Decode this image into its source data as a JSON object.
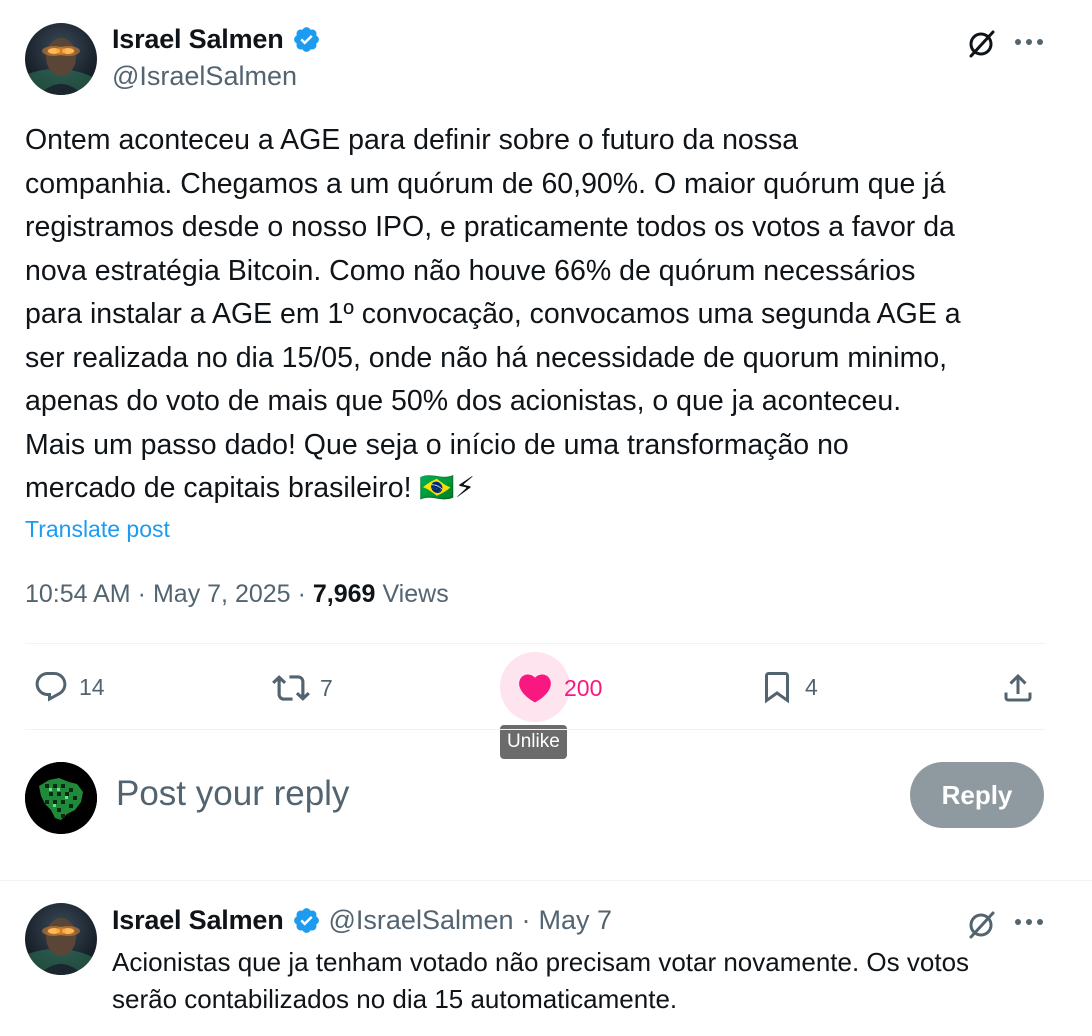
{
  "post": {
    "author_name": "Israel Salmen",
    "author_handle": "@IsraelSalmen",
    "text_lines": [
      "Ontem aconteceu a AGE para definir sobre o futuro da nossa",
      "companhia. Chegamos a um quórum de 60,90%. O maior quórum que já",
      "registramos desde o nosso IPO, e praticamente todos os votos a favor da",
      "nova estratégia Bitcoin. Como não houve 66% de quórum necessários",
      "para instalar a AGE em 1º convocação, convocamos uma segunda AGE a",
      "ser realizada no dia 15/05, onde não há necessidade de quorum minimo,",
      "apenas do voto de mais que 50% dos acionistas, o que ja aconteceu.",
      "Mais um passo dado! Que seja o início de uma transformação no",
      "mercado de capitais brasileiro! 🇧🇷⚡"
    ],
    "translate_label": "Translate post",
    "time": "10:54 AM",
    "date": "May 7, 2025",
    "views_count": "7,969",
    "views_label": "Views",
    "separator": "·"
  },
  "actions": {
    "replies": "14",
    "reposts": "7",
    "likes": "200",
    "bookmarks": "4",
    "like_tooltip": "Unlike"
  },
  "composer": {
    "placeholder": "Post your reply",
    "reply_button": "Reply"
  },
  "reply": {
    "author_name": "Israel Salmen",
    "author_handle": "@IsraelSalmen",
    "date": "May 7",
    "separator": "·",
    "text_lines": [
      "Acionistas que ja tenham votado não precisam votar novamente. Os votos",
      "serão contabilizados no dia 15 automaticamente."
    ]
  },
  "icons": {
    "verified": "verified-badge-icon",
    "grok": "grok-icon",
    "more": "more-icon",
    "reply": "reply-icon",
    "repost": "repost-icon",
    "like": "heart-icon",
    "bookmark": "bookmark-icon",
    "share": "share-icon"
  },
  "colors": {
    "accent": "#1d9bf0",
    "like": "#f91880",
    "text": "#0f1419",
    "muted": "#536471",
    "reply_button_bg": "#8f9aa0"
  }
}
